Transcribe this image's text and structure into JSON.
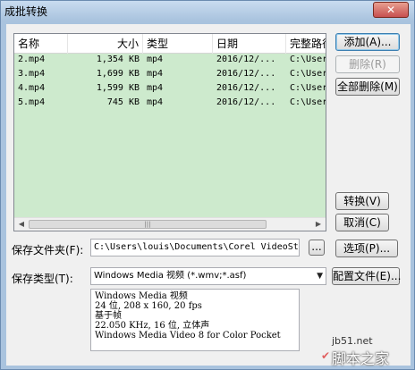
{
  "window": {
    "title": "成批转换",
    "close_icon": "close-icon"
  },
  "list": {
    "columns": [
      "名称",
      "大小",
      "类型",
      "日期",
      "完整路径"
    ],
    "rows": [
      {
        "name": "2.mp4",
        "size": "1,354 KB",
        "type": "mp4",
        "date": "2016/12/...",
        "path": "C:\\Users"
      },
      {
        "name": "3.mp4",
        "size": "1,699 KB",
        "type": "mp4",
        "date": "2016/12/...",
        "path": "C:\\Users"
      },
      {
        "name": "4.mp4",
        "size": "1,599 KB",
        "type": "mp4",
        "date": "2016/12/...",
        "path": "C:\\Users"
      },
      {
        "name": "5.mp4",
        "size": "745 KB",
        "type": "mp4",
        "date": "2016/12/...",
        "path": "C:\\Users"
      }
    ],
    "scroll_grip": "|||"
  },
  "buttons": {
    "add": "添加(A)...",
    "delete": "删除(R)",
    "delete_all": "全部删除(M)",
    "convert": "转换(V)",
    "cancel": "取消(C)",
    "browse": "...",
    "options": "选项(P)...",
    "profile": "配置文件(E)..."
  },
  "save_folder": {
    "label": "保存文件夹(F):",
    "value": "C:\\Users\\louis\\Documents\\Corel VideoStu"
  },
  "save_type": {
    "label": "保存类型(T):",
    "value": "Windows Media 视频 (*.wmv;*.asf)"
  },
  "info": [
    "Windows Media 视频",
    "24 位, 208 x 160, 20 fps",
    "基于帧",
    "22.050 KHz, 16 位, 立体声",
    "Windows Media Video 8 for Color Pocket"
  ],
  "watermark": {
    "url": "jb51.net",
    "name": "脚本之家"
  }
}
